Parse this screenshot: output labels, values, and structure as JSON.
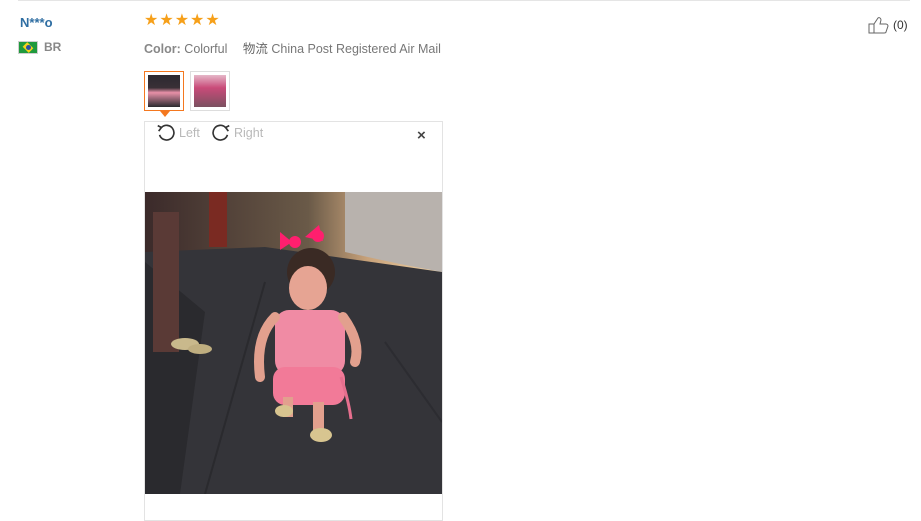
{
  "review": {
    "user_name": "N***o",
    "country": "BR",
    "rating": 5,
    "color_label": "Color:",
    "color_value": "Colorful",
    "shipping_label": "物流",
    "shipping_value": "China Post Registered Air Mail",
    "helpful_count": "(0)"
  },
  "viewer": {
    "rotate_left_label": "Left",
    "rotate_right_label": "Right",
    "close_symbol": "×"
  },
  "colors": {
    "star": "#f6a01a",
    "name": "#2f6ea2",
    "active_thumb": "#f4781f"
  },
  "icons": [
    "thumbs-up-icon",
    "rotate-left-icon",
    "rotate-right-icon",
    "close-icon",
    "star-icon",
    "brazil-flag-icon"
  ]
}
